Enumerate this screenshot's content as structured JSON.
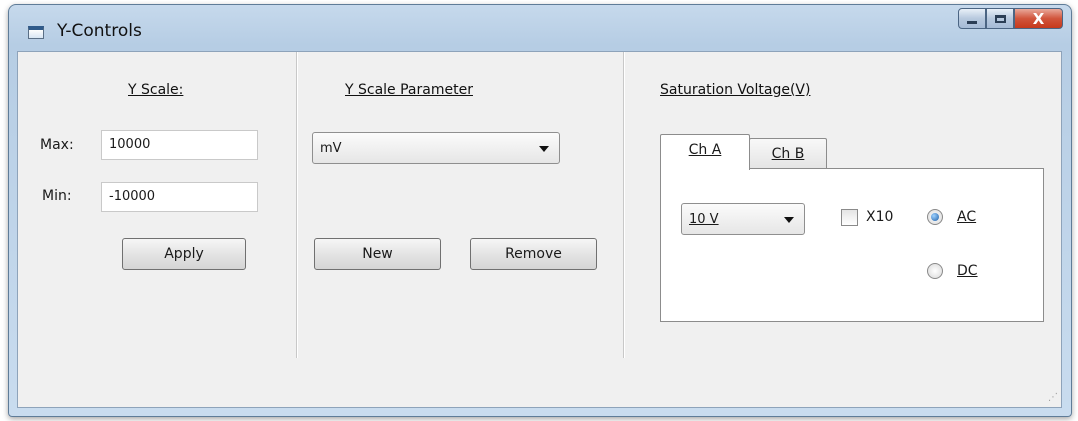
{
  "window": {
    "title": "Y-Controls",
    "controls": {
      "close_glyph": "X"
    }
  },
  "y_scale": {
    "heading": "Y Scale:",
    "max_label": "Max:",
    "max_value": "10000",
    "min_label": "Min:",
    "min_value": "-10000",
    "apply_label": "Apply"
  },
  "y_scale_parameter": {
    "heading": "Y Scale Parameter",
    "selected": "mV",
    "new_label": "New",
    "remove_label": "Remove"
  },
  "saturation": {
    "heading": "Saturation Voltage(V)",
    "tabs": [
      {
        "label": "Ch A",
        "active": true
      },
      {
        "label": "Ch B",
        "active": false
      }
    ],
    "voltage_selected": "10 V",
    "x10_label": "X10",
    "x10_checked": false,
    "coupling": [
      {
        "label": "AC",
        "selected": true
      },
      {
        "label": "DC",
        "selected": false
      }
    ]
  },
  "icons": {
    "app": "window-app-icon",
    "minimize": "minimize-icon",
    "maximize": "maximize-icon",
    "close": "close-icon",
    "dropdown": "chevron-down-icon",
    "resize": "resize-grip-icon"
  }
}
